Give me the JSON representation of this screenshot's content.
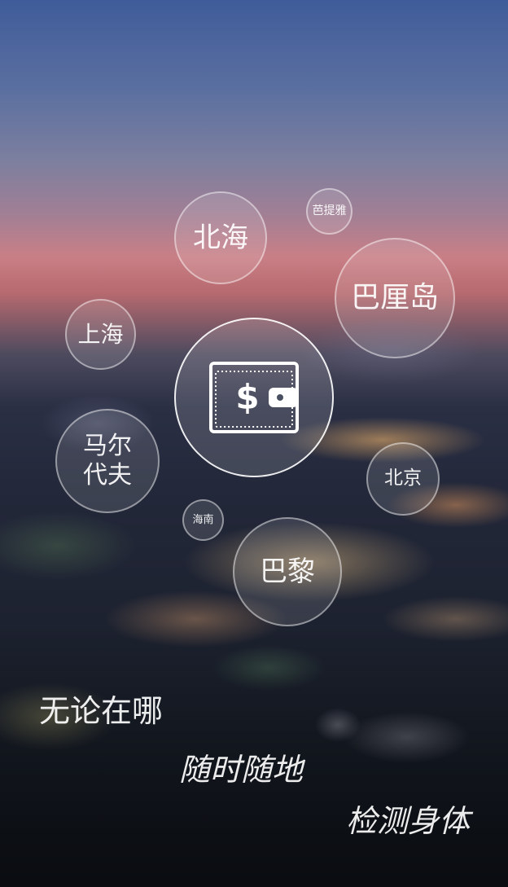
{
  "destinations": {
    "beihai": "北海",
    "pattaya": "芭提雅",
    "bali": "巴厘岛",
    "shanghai": "上海",
    "maldives": "马尔\n代夫",
    "beijing": "北京",
    "hainan": "海南",
    "paris": "巴黎"
  },
  "center": {
    "icon": "wallet-dollar-icon",
    "symbol": "$"
  },
  "slogans": {
    "line1": "无论在哪",
    "line2": "随时随地",
    "line3": "检测身体"
  },
  "colors": {
    "bubble_border": "#ffffff",
    "text": "#ffffff"
  }
}
